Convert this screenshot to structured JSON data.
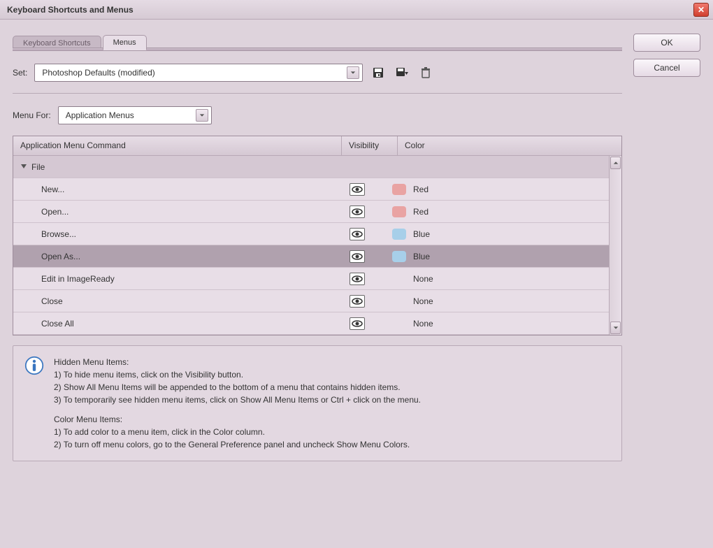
{
  "title": "Keyboard Shortcuts and Menus",
  "buttons": {
    "ok": "OK",
    "cancel": "Cancel"
  },
  "tabs": {
    "shortcuts": "Keyboard Shortcuts",
    "menus": "Menus"
  },
  "set": {
    "label": "Set:",
    "value": "Photoshop Defaults (modified)"
  },
  "menuFor": {
    "label": "Menu For:",
    "value": "Application Menus"
  },
  "table": {
    "headers": {
      "command": "Application Menu Command",
      "visibility": "Visibility",
      "color": "Color"
    },
    "group": "File",
    "rows": [
      {
        "label": "New...",
        "color": "Red",
        "swatch": "red"
      },
      {
        "label": "Open...",
        "color": "Red",
        "swatch": "red"
      },
      {
        "label": "Browse...",
        "color": "Blue",
        "swatch": "blue"
      },
      {
        "label": "Open As...",
        "color": "Blue",
        "swatch": "blue",
        "selected": true
      },
      {
        "label": "Edit in ImageReady",
        "color": "None",
        "swatch": ""
      },
      {
        "label": "Close",
        "color": "None",
        "swatch": ""
      },
      {
        "label": "Close All",
        "color": "None",
        "swatch": ""
      }
    ]
  },
  "info": {
    "hiddenTitle": "Hidden Menu Items:",
    "hidden1": "1) To hide menu items, click on the Visibility button.",
    "hidden2": "2) Show All Menu Items will be appended to the bottom of a menu that contains hidden items.",
    "hidden3": "3) To temporarily see hidden menu items, click on Show All Menu Items or Ctrl + click on the menu.",
    "colorTitle": "Color Menu Items:",
    "color1": "1) To add color to a menu item, click in the Color column.",
    "color2": "2) To turn off menu colors, go to the General Preference panel and uncheck Show Menu Colors."
  }
}
